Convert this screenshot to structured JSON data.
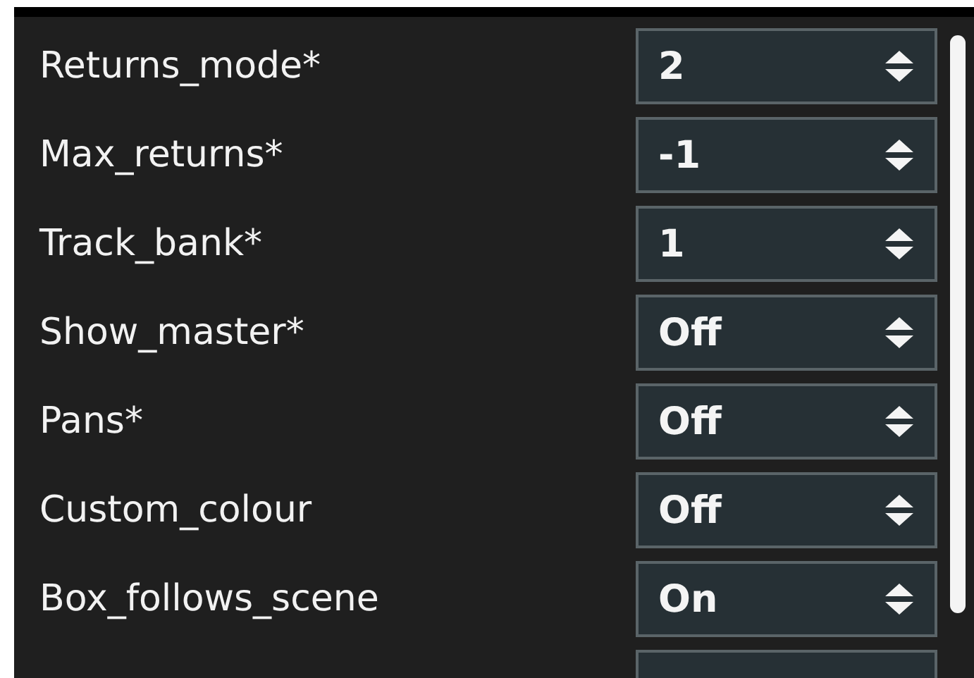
{
  "settings": [
    {
      "label": "Returns_mode*",
      "value": "2"
    },
    {
      "label": "Max_returns*",
      "value": "-1"
    },
    {
      "label": "Track_bank*",
      "value": "1"
    },
    {
      "label": "Show_master*",
      "value": "Off"
    },
    {
      "label": "Pans*",
      "value": "Off"
    },
    {
      "label": "Custom_colour",
      "value": "Off"
    },
    {
      "label": "Box_follows_scene",
      "value": "On"
    }
  ]
}
